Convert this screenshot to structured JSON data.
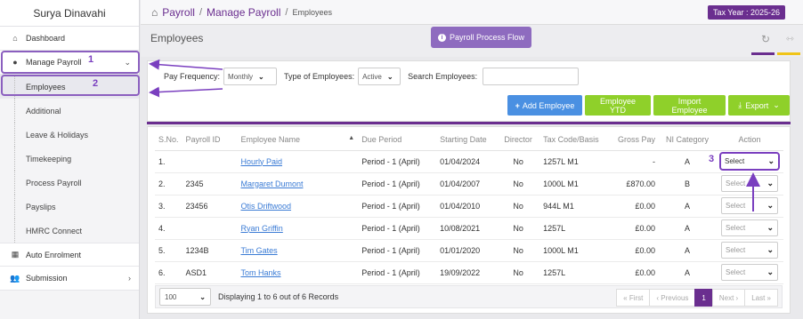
{
  "sidebar": {
    "user_name": "Surya Dinavahi",
    "items": [
      {
        "label": "Dashboard",
        "icon": "home-icon"
      },
      {
        "label": "Manage Payroll",
        "icon": "user-icon"
      }
    ],
    "sub_items": [
      "Employees",
      "Additional",
      "Leave & Holidays",
      "Timekeeping",
      "Process Payroll",
      "Payslips",
      "HMRC Connect"
    ],
    "bottom_items": [
      {
        "label": "Auto Enrolment",
        "icon": "grid-icon"
      },
      {
        "label": "Submission",
        "icon": "users-icon"
      }
    ]
  },
  "breadcrumb": {
    "root": "Payroll",
    "section": "Manage Payroll",
    "current": "Employees"
  },
  "tax_year": "Tax Year : 2025-26",
  "page": {
    "title": "Employees",
    "flow_button": "Payroll Process Flow"
  },
  "filters": {
    "pay_frequency_label": "Pay Frequency:",
    "pay_frequency_value": "Monthly",
    "type_label": "Type of Employees:",
    "type_value": "Active",
    "search_label": "Search Employees:",
    "search_value": ""
  },
  "actions": {
    "add": "Add Employee",
    "ytd": "Employee YTD",
    "import": "Import Employee",
    "export": "Export"
  },
  "table": {
    "headers": [
      "S.No.",
      "Payroll ID",
      "Employee Name",
      "Due Period",
      "Starting Date",
      "Director",
      "Tax Code/Basis",
      "Gross Pay",
      "NI Category",
      "Action"
    ],
    "rows": [
      {
        "sno": "1.",
        "pid": "",
        "name": "Hourly Paid",
        "due": "Period - 1 (April)",
        "start": "01/04/2024",
        "dir": "No",
        "tax": "1257L M1",
        "gross": "-",
        "ni": "A",
        "action": "Select"
      },
      {
        "sno": "2.",
        "pid": "2345",
        "name": "Margaret Dumont",
        "due": "Period - 1 (April)",
        "start": "01/04/2007",
        "dir": "No",
        "tax": "1000L M1",
        "gross": "£870.00",
        "ni": "B",
        "action": "Select"
      },
      {
        "sno": "3.",
        "pid": "23456",
        "name": "Otis Driftwood",
        "due": "Period - 1 (April)",
        "start": "01/04/2010",
        "dir": "No",
        "tax": "944L M1",
        "gross": "£0.00",
        "ni": "A",
        "action": "Select"
      },
      {
        "sno": "4.",
        "pid": "",
        "name": "Ryan Griffin",
        "due": "Period - 1 (April)",
        "start": "10/08/2021",
        "dir": "No",
        "tax": "1257L",
        "gross": "£0.00",
        "ni": "A",
        "action": "Select"
      },
      {
        "sno": "5.",
        "pid": "1234B",
        "name": "Tim Gates",
        "due": "Period - 1 (April)",
        "start": "01/01/2020",
        "dir": "No",
        "tax": "1000L M1",
        "gross": "£0.00",
        "ni": "A",
        "action": "Select"
      },
      {
        "sno": "6.",
        "pid": "ASD1",
        "name": "Tom Hanks",
        "due": "Period - 1 (April)",
        "start": "19/09/2022",
        "dir": "No",
        "tax": "1257L",
        "gross": "£0.00",
        "ni": "A",
        "action": "Select"
      }
    ]
  },
  "footer": {
    "page_size": "100",
    "records": "Displaying 1 to 6 out of 6 Records",
    "pager": [
      "« First",
      "‹ Previous",
      "1",
      "Next ›",
      "Last »"
    ]
  },
  "annotations": [
    "1",
    "2",
    "3"
  ],
  "colors": {
    "brand_purple": "#6a2e8f",
    "accent_blue": "#4a90e2",
    "accent_green": "#8fd02a"
  }
}
